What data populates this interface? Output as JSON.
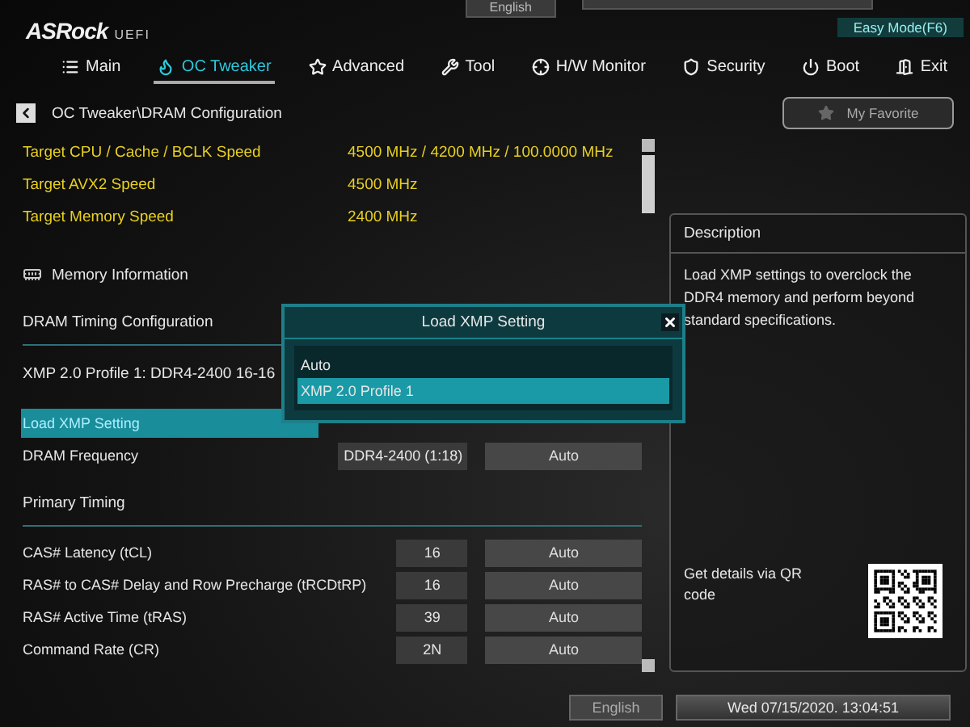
{
  "header": {
    "logo": "ASRock",
    "logo_suffix": "UEFI",
    "top_language": "English",
    "easy_mode": "Easy Mode(F6)"
  },
  "tabs": [
    {
      "label": "Main",
      "selected": false
    },
    {
      "label": "OC Tweaker",
      "selected": true
    },
    {
      "label": "Advanced",
      "selected": false
    },
    {
      "label": "Tool",
      "selected": false
    },
    {
      "label": "H/W Monitor",
      "selected": false
    },
    {
      "label": "Security",
      "selected": false
    },
    {
      "label": "Boot",
      "selected": false
    },
    {
      "label": "Exit",
      "selected": false
    }
  ],
  "breadcrumb": "OC Tweaker\\DRAM Configuration",
  "favorite": "My Favorite",
  "info_rows": [
    {
      "label": "Target CPU / Cache / BCLK Speed",
      "value": "4500 MHz / 4200 MHz / 100.0000 MHz"
    },
    {
      "label": "Target AVX2 Speed",
      "value": "4500 MHz"
    },
    {
      "label": "Target Memory Speed",
      "value": "2400 MHz"
    }
  ],
  "items": [
    {
      "kind": "submenu",
      "label": "Memory Information"
    },
    {
      "kind": "heading",
      "label": "DRAM Timing Configuration"
    },
    {
      "kind": "text",
      "label": "XMP 2.0 Profile 1: DDR4-2400 16-16"
    },
    {
      "kind": "setting",
      "label": "Load XMP Setting",
      "selected": true
    },
    {
      "kind": "setting",
      "label": "DRAM Frequency",
      "value": "DDR4-2400 (1:18)",
      "option": "Auto",
      "selected": false
    },
    {
      "kind": "heading",
      "label": "Primary Timing"
    },
    {
      "kind": "setting",
      "label": "CAS# Latency (tCL)",
      "value": "16",
      "option": "Auto",
      "selected": false
    },
    {
      "kind": "setting",
      "label": "RAS# to CAS# Delay and Row Precharge (tRCDtRP)",
      "value": "16",
      "option": "Auto",
      "selected": false
    },
    {
      "kind": "setting",
      "label": "RAS# Active Time (tRAS)",
      "value": "39",
      "option": "Auto",
      "selected": false
    },
    {
      "kind": "setting",
      "label": "Command Rate (CR)",
      "value": "2N",
      "option": "Auto",
      "selected": false
    }
  ],
  "dialog": {
    "title": "Load XMP Setting",
    "options": [
      {
        "label": "Auto",
        "selected": false
      },
      {
        "label": "XMP 2.0 Profile 1",
        "selected": true
      }
    ]
  },
  "description": {
    "title": "Description",
    "text": "Load XMP settings to overclock the DDR4 memory and perform beyond standard specifications.",
    "qr_text": "Get details via QR code"
  },
  "status_bar": {
    "language": "English",
    "datetime": "Wed 07/15/2020. 13:04:51"
  }
}
